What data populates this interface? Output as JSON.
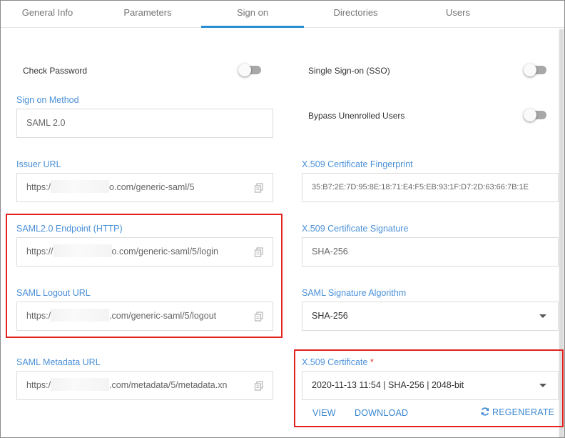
{
  "tabs": [
    {
      "label": "General Info"
    },
    {
      "label": "Parameters"
    },
    {
      "label": "Sign on"
    },
    {
      "label": "Directories"
    },
    {
      "label": "Users"
    }
  ],
  "check_password": {
    "label": "Check Password",
    "on": false
  },
  "sso": {
    "label": "Single Sign-on (SSO)",
    "on": false
  },
  "bypass": {
    "label": "Bypass Unenrolled Users",
    "on": false
  },
  "sign_on_method": {
    "label": "Sign on Method",
    "value": "SAML 2.0"
  },
  "issuer_url": {
    "label": "Issuer URL",
    "prefix": "https:/",
    "suffix": "o.com/generic-saml/5"
  },
  "fingerprint": {
    "label": "X.509 Certificate Fingerprint",
    "value": "35:B7:2E:7D:95:8E:18:71:E4:F5:EB:93:1F:D7:2D:63:66:7B:1E"
  },
  "endpoint": {
    "label": "SAML2.0 Endpoint (HTTP)",
    "prefix": "https://",
    "suffix": "o.com/generic-saml/5/login"
  },
  "cert_signature": {
    "label": "X.509 Certificate Signature",
    "value": "SHA-256"
  },
  "logout_url": {
    "label": "SAML Logout URL",
    "prefix": "https:/",
    "suffix": ".com/generic-saml/5/logout"
  },
  "sig_algorithm": {
    "label": "SAML Signature Algorithm",
    "value": "SHA-256"
  },
  "metadata_url": {
    "label": "SAML Metadata URL",
    "prefix": "https:/",
    "suffix": ".com/metadata/5/metadata.xn"
  },
  "certificate": {
    "label": "X.509 Certificate",
    "required_mark": "*",
    "value": "2020-11-13 11:54 | SHA-256 | 2048-bit"
  },
  "actions": {
    "view": "VIEW",
    "download": "DOWNLOAD",
    "regenerate": "REGENERATE"
  },
  "colors": {
    "accent": "#2b8fd6",
    "label_blue": "#4a90d9",
    "highlight": "#e3211d"
  }
}
